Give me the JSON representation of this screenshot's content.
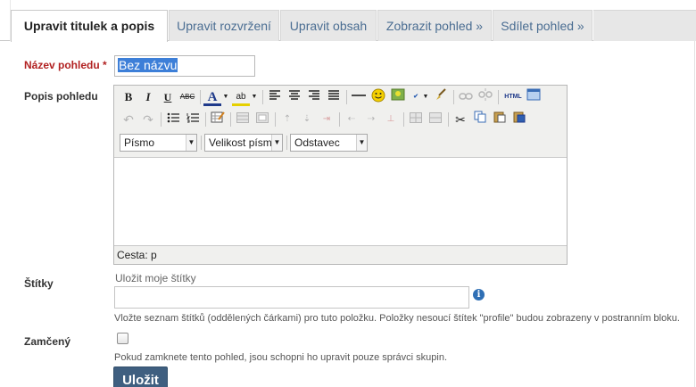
{
  "tabs": [
    {
      "label": "Upravit titulek a popis",
      "active": true
    },
    {
      "label": "Upravit rozvržení",
      "active": false
    },
    {
      "label": "Upravit obsah",
      "active": false
    },
    {
      "label": "Zobrazit pohled »",
      "active": false
    },
    {
      "label": "Sdílet pohled »",
      "active": false
    }
  ],
  "form": {
    "title_label": "Název pohledu",
    "required_marker": "*",
    "title_value": "Bez názvu",
    "description_label": "Popis pohledu",
    "tags_label": "Štítky",
    "tags_hint": "Uložit moje štítky",
    "tags_value": "",
    "tags_help": "Vložte seznam štítků (oddělených čárkami) pro tuto položku. Položky nesoucí štítek \"profile\" budou zobrazeny v postranním bloku.",
    "locked_label": "Zamčený",
    "locked_checked": false,
    "locked_help": "Pokud zamknete tento pohled, jsou schopni ho upravit pouze správci skupin.",
    "save_label": "Uložit"
  },
  "editor": {
    "font_select": "Písmo",
    "size_select": "Velikost písma",
    "format_select": "Odstavec",
    "path_label": "Cesta: p",
    "toolbar_texts": {
      "bold": "B",
      "italic": "I",
      "underline": "U",
      "strike": "ABC",
      "font_color": "A",
      "highlight": "ab",
      "html": "HTML"
    }
  },
  "colors": {
    "accent": "#3f5f80",
    "tab_link": "#4a6d92",
    "required": "#b22222",
    "selection": "#3d7fd8"
  }
}
